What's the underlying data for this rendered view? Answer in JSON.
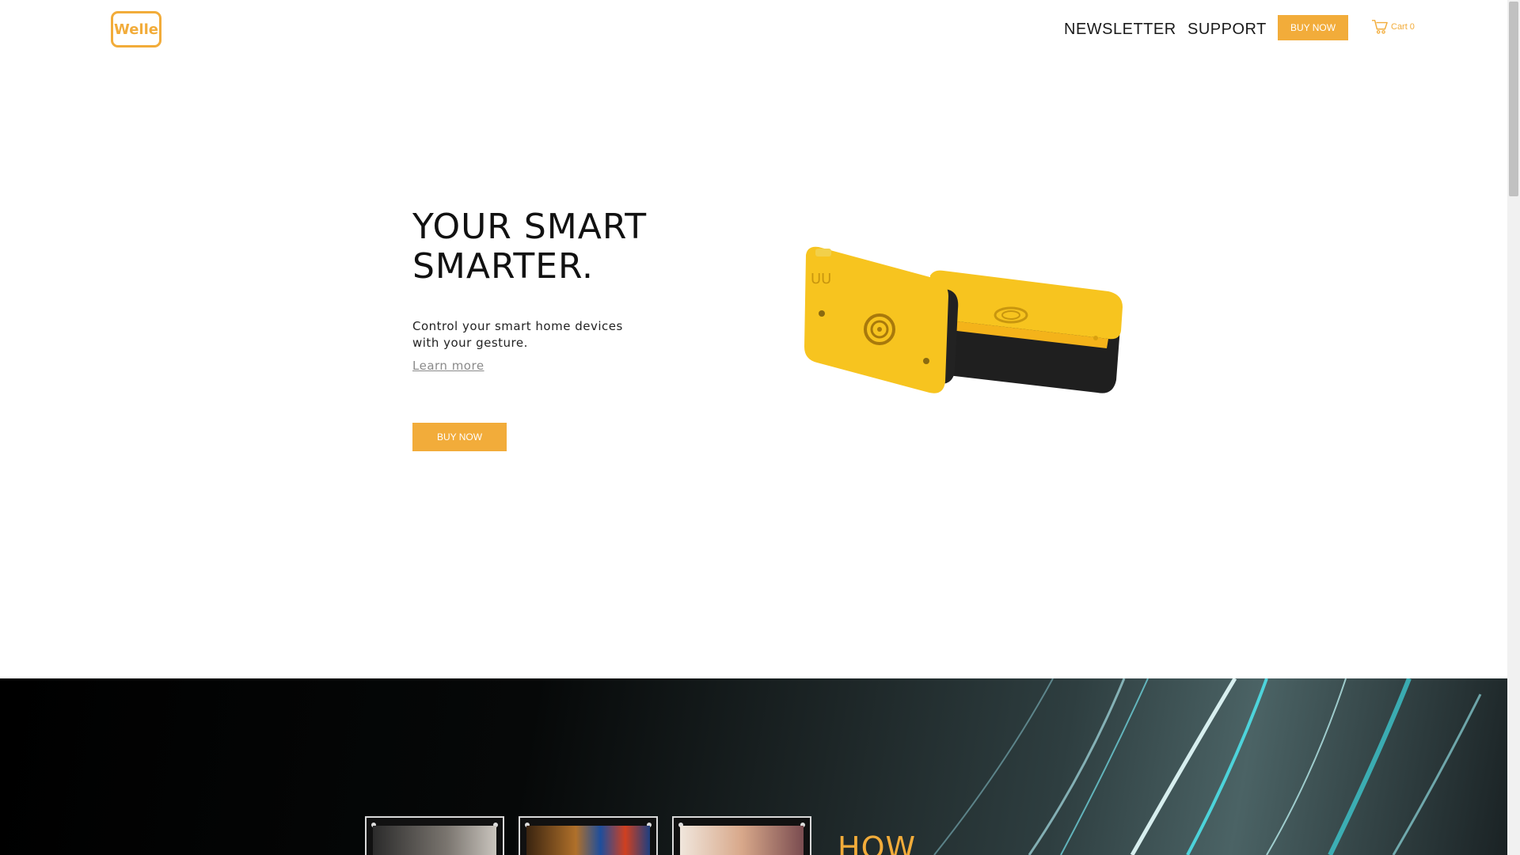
{
  "header": {
    "logo_text": "Welle",
    "nav": [
      {
        "label": "NEWSLETTER"
      },
      {
        "label": "SUPPORT"
      }
    ],
    "buy_label": "BUY NOW",
    "cart_label": "Cart",
    "cart_count": "0",
    "accent_color": "#f2ac3a"
  },
  "hero": {
    "title_line1": "YOUR SMART",
    "title_line2": "SMARTER.",
    "description": "Control your smart home devices with your gesture.",
    "learn_more": "Learn more",
    "buy_label": "BUY NOW"
  },
  "section2": {
    "heading": "HOW",
    "thumbnails": [
      {
        "icon": "bedroom-photo"
      },
      {
        "icon": "city-tv-photo"
      },
      {
        "icon": "lamp-photo"
      }
    ]
  }
}
